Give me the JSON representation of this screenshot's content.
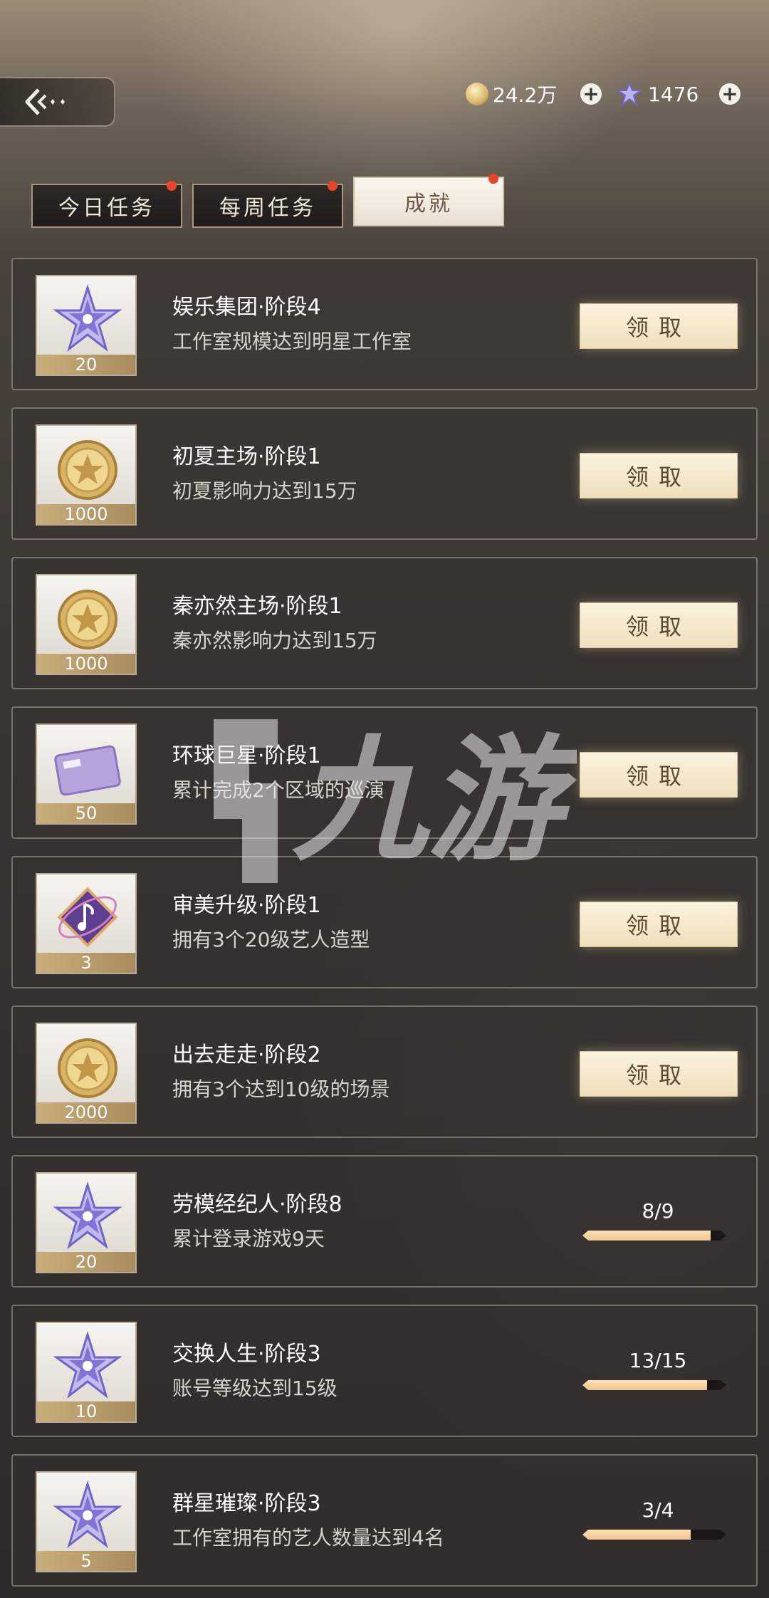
{
  "header": {
    "coins": "24.2万",
    "stars": "1476"
  },
  "tabs": [
    {
      "label": "今日任务",
      "badge": true,
      "active": false
    },
    {
      "label": "每周任务",
      "badge": true,
      "active": false
    },
    {
      "label": "成就",
      "badge": true,
      "active": true
    }
  ],
  "achievements": [
    {
      "title": "娱乐集团·阶段4",
      "desc": "工作室规模达到明星工作室",
      "reward_icon": "star-icon",
      "reward_count": "20",
      "action": "领取"
    },
    {
      "title": "初夏主场·阶段1",
      "desc": "初夏影响力达到15万",
      "reward_icon": "coin-icon",
      "reward_count": "1000",
      "action": "领取"
    },
    {
      "title": "秦亦然主场·阶段1",
      "desc": "秦亦然影响力达到15万",
      "reward_icon": "coin-icon",
      "reward_count": "1000",
      "action": "领取"
    },
    {
      "title": "环球巨星·阶段1",
      "desc": "累计完成2个区域的巡演",
      "reward_icon": "vip-card-icon",
      "reward_count": "50",
      "action": "领取"
    },
    {
      "title": "审美升级·阶段1",
      "desc": "拥有3个20级艺人造型",
      "reward_icon": "music-note-icon",
      "reward_count": "3",
      "action": "领取"
    },
    {
      "title": "出去走走·阶段2",
      "desc": "拥有3个达到10级的场景",
      "reward_icon": "coin-icon",
      "reward_count": "2000",
      "action": "领取"
    },
    {
      "title": "劳模经纪人·阶段8",
      "desc": "累计登录游戏9天",
      "reward_icon": "star-icon",
      "reward_count": "20",
      "progress": "8/9",
      "progress_fraction": 0.889
    },
    {
      "title": "交换人生·阶段3",
      "desc": "账号等级达到15级",
      "reward_icon": "star-icon",
      "reward_count": "10",
      "progress": "13/15",
      "progress_fraction": 0.867
    },
    {
      "title": "群星璀璨·阶段3",
      "desc": "工作室拥有的艺人数量达到4名",
      "reward_icon": "star-icon",
      "reward_count": "5",
      "progress": "3/4",
      "progress_fraction": 0.75
    }
  ],
  "watermark": "九游",
  "colors": {
    "badge": "#e8442a",
    "progress_fill": "#f0c48f",
    "claim_bg": "#f5e8c9"
  }
}
